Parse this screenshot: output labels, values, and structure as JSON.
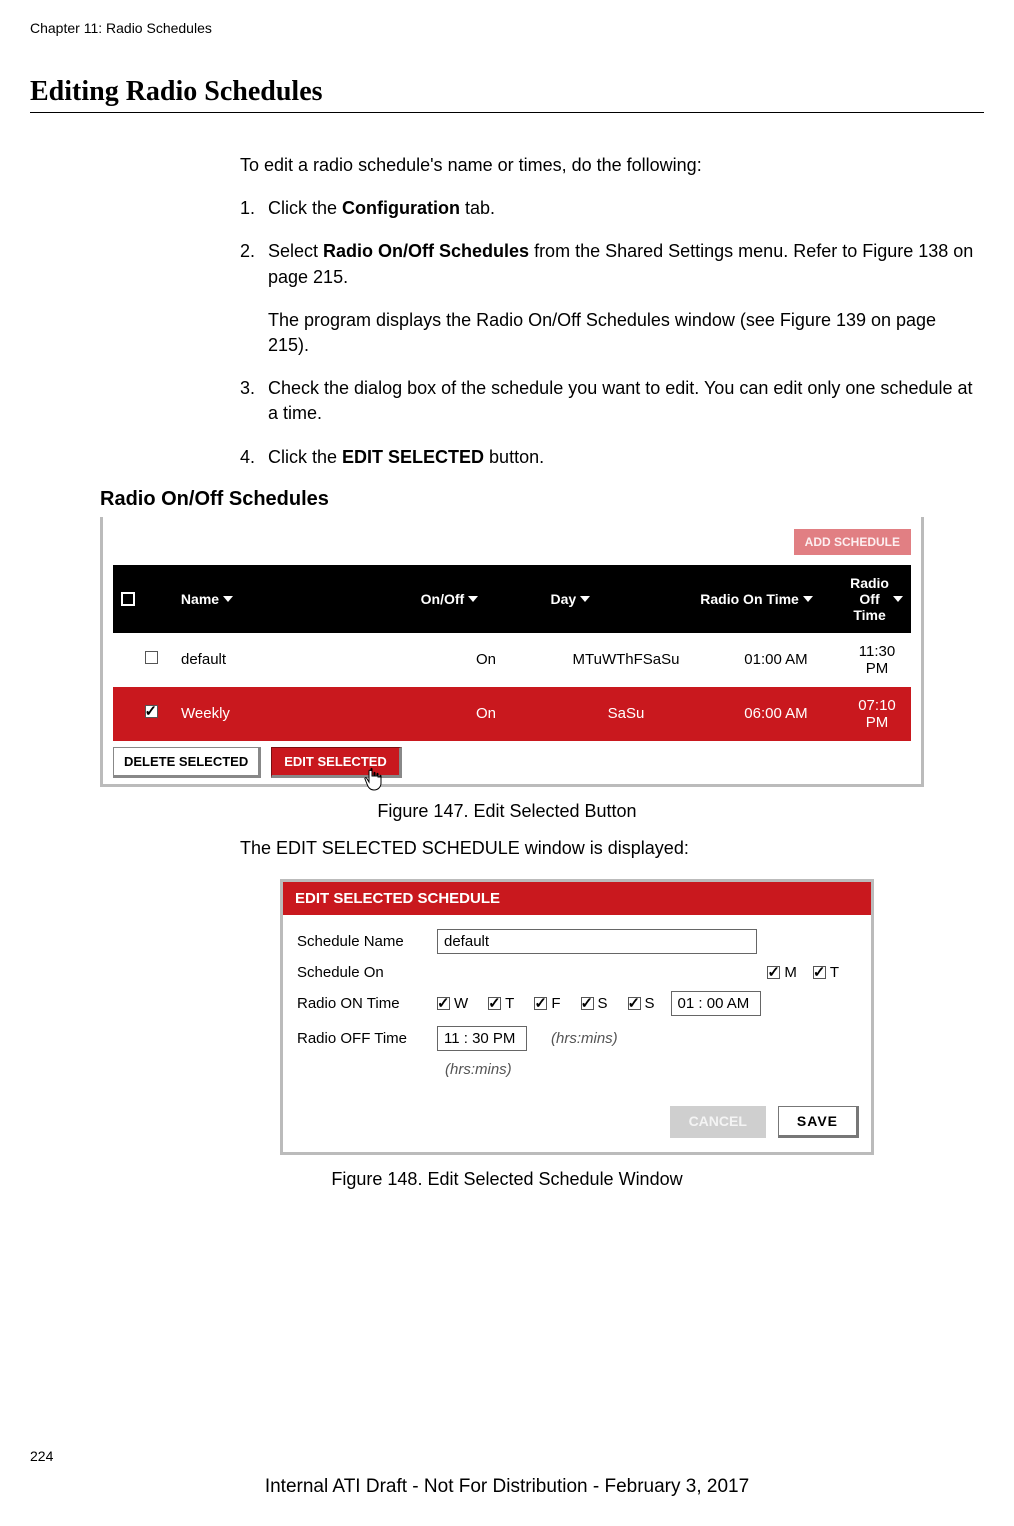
{
  "header": {
    "chapter": "Chapter 11: Radio Schedules"
  },
  "section": {
    "title": "Editing Radio Schedules"
  },
  "intro": "To edit a radio schedule's name or times, do the following:",
  "steps": [
    {
      "num": "1.",
      "parts": [
        {
          "t": "Click the "
        },
        {
          "t": "Configuration",
          "b": true
        },
        {
          "t": " tab."
        }
      ]
    },
    {
      "num": "2.",
      "parts": [
        {
          "t": "Select "
        },
        {
          "t": "Radio On/Off Schedules",
          "b": true
        },
        {
          "t": " from the Shared Settings menu. Refer to Figure 138 on page 215."
        }
      ],
      "extra": "The program displays the Radio On/Off Schedules window (see Figure 139 on page 215)."
    },
    {
      "num": "3.",
      "parts": [
        {
          "t": "Check the dialog box of the schedule you want to edit. You can edit only one schedule at a time."
        }
      ]
    },
    {
      "num": "4.",
      "parts": [
        {
          "t": "Click the "
        },
        {
          "t": "EDIT SELECTED",
          "b": true
        },
        {
          "t": " button."
        }
      ]
    }
  ],
  "fig1": {
    "title": "Radio On/Off Schedules",
    "add_btn": "ADD SCHEDULE",
    "cols": {
      "name": "Name",
      "onoff": "On/Off",
      "day": "Day",
      "on": "Radio On Time",
      "off": "Radio Off Time"
    },
    "rows": [
      {
        "checked": false,
        "name": "default",
        "onoff": "On",
        "day": "MTuWThFSaSu",
        "on": "01:00 AM",
        "off": "11:30 PM"
      },
      {
        "checked": true,
        "name": "Weekly",
        "onoff": "On",
        "day": "SaSu",
        "on": "06:00 AM",
        "off": "07:10 PM"
      }
    ],
    "delete_btn": "DELETE SELECTED",
    "edit_btn": "EDIT SELECTED",
    "caption": "Figure 147. Edit Selected Button"
  },
  "mid_text": "The EDIT SELECTED SCHEDULE window is displayed:",
  "fig2": {
    "header": "EDIT SELECTED SCHEDULE",
    "labels": {
      "name": "Schedule Name",
      "on": "Schedule On",
      "ron": "Radio ON Time",
      "roff": "Radio OFF Time"
    },
    "name_value": "default",
    "days_row1": [
      {
        "l": "M",
        "c": true
      },
      {
        "l": "T",
        "c": true
      }
    ],
    "days_row2": [
      {
        "l": "W",
        "c": true
      },
      {
        "l": "T",
        "c": true
      },
      {
        "l": "F",
        "c": true
      },
      {
        "l": "S",
        "c": true
      },
      {
        "l": "S",
        "c": true
      }
    ],
    "on_time": "01 : 00 AM",
    "off_time": "11 : 30 PM",
    "hint": "(hrs:mins)",
    "hint2": "(hrs:mins)",
    "cancel": "CANCEL",
    "save": "SAVE",
    "caption": "Figure 148. Edit Selected Schedule Window"
  },
  "page_num": "224",
  "footer": "Internal ATI Draft - Not For Distribution - February 3, 2017"
}
